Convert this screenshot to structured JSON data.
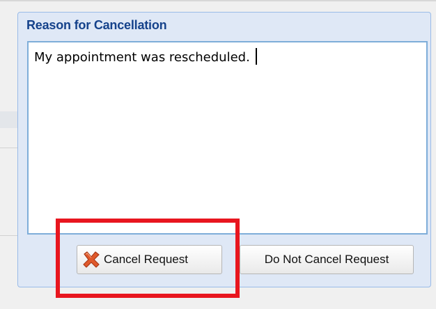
{
  "dialog": {
    "title": "Reason for Cancellation",
    "reason_value": "My appointment was rescheduled. "
  },
  "buttons": {
    "cancel_request": "Cancel Request",
    "do_not_cancel": "Do Not Cancel Request"
  },
  "icons": {
    "cancel_icon": "red-x-icon"
  },
  "colors": {
    "title": "#15428b",
    "dialog_bg": "#dfe8f6",
    "dialog_border": "#99bbe8",
    "textarea_border": "#7eadd9",
    "highlight": "#e8161f",
    "x_icon": "#e0592b"
  }
}
